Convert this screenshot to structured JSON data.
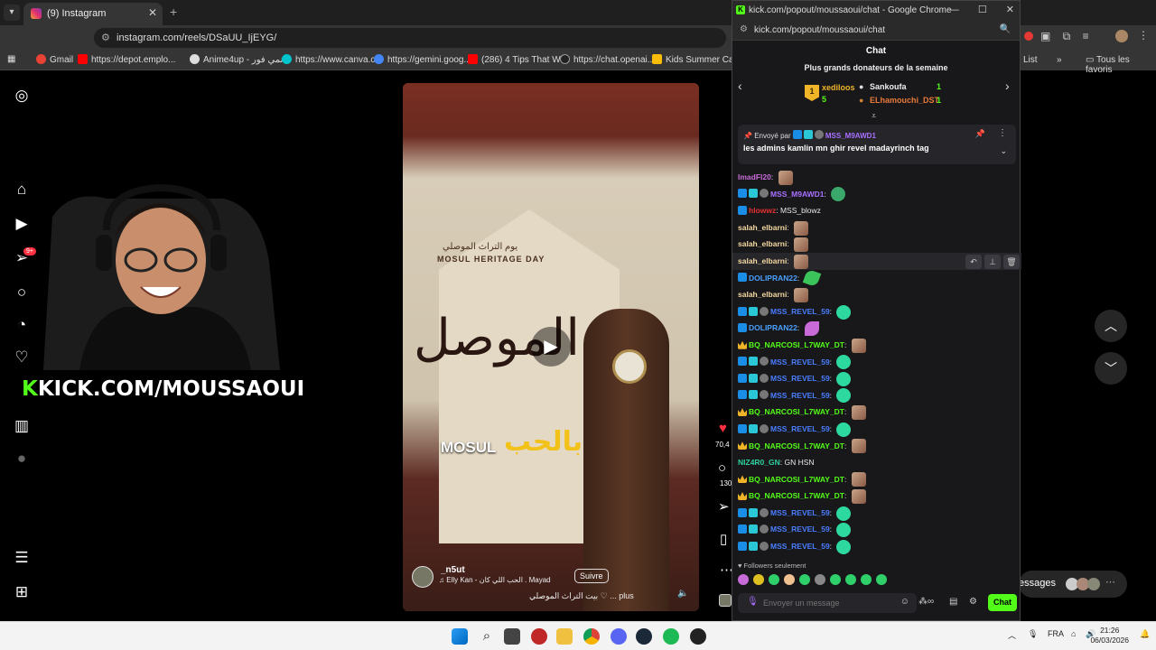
{
  "browser": {
    "tab_title": "(9) Instagram",
    "url": "instagram.com/reels/DSaUU_IjEYG/",
    "bookmarks": [
      "Gmail",
      "https://depot.emplo...",
      "Anime4up - انمي فور",
      "https://www.canva.c...",
      "https://gemini.goog...",
      "(286) 4 Tips That Wi...",
      "https://chat.openai....",
      "Kids Summer Camp..."
    ],
    "bookmarks_right": [
      "List",
      "Tous les favoris"
    ]
  },
  "overlay": {
    "kick_label": "KICK.COM/MOUSSAOUI",
    "kick_k": "K"
  },
  "instagram": {
    "notif_count": "9+",
    "reel": {
      "arabic_title": "الموصل",
      "small_arabic": "يوم التراث الموصلي",
      "small_english": "MOSUL HERITAGE DAY",
      "overlay_mosul": "MOSUL",
      "overlay_arabic": "بالحب",
      "user": "_n5ut",
      "follow": "Suivre",
      "music": "♫ Elly Kan - الحب اللي كان . Mayad",
      "caption": "بيت التراث الموصلي ♡ ... plus"
    },
    "actions": {
      "likes": "70,4",
      "comments": "130"
    },
    "messages_label": "essages"
  },
  "chat_window": {
    "title": "kick.com/popout/moussaoui/chat - Google Chrome",
    "url": "kick.com/popout/moussaoui/chat",
    "header": "Chat",
    "donors_title": "Plus grands donateurs de la semaine",
    "donors": [
      {
        "rank": "1",
        "name": "xediloos",
        "amount": "5"
      },
      {
        "name": "Sankoufa",
        "amount": "1"
      },
      {
        "name": "ELhamouchi_DST",
        "amount": "1"
      }
    ],
    "pinned": {
      "sent_by": "Envoyé par",
      "user": "MSS_M9AWD1",
      "message": "les admins kamlin mn ghir revel madayrinch tag"
    },
    "messages": [
      {
        "user": "ImadFl20",
        "color": "#c86bd8",
        "badges": [],
        "text": "",
        "emote": "em-photo"
      },
      {
        "user": "MSS_M9AWD1",
        "color": "#a970ff",
        "badges": [
          "b-mod",
          "b-vip",
          "b-gift"
        ],
        "text": "",
        "emote": "em-globe"
      },
      {
        "user": "hlowwz",
        "color": "#e83030",
        "badges": [
          "b-mod"
        ],
        "text": "MSS_blowz",
        "emote": ""
      },
      {
        "user": "salah_elbarni",
        "color": "#f5d8a0",
        "badges": [],
        "text": "",
        "emote": "em-photo"
      },
      {
        "user": "salah_elbarni",
        "color": "#f5d8a0",
        "badges": [],
        "text": "",
        "emote": "em-photo"
      },
      {
        "user": "salah_elbarni",
        "color": "#f5d8a0",
        "badges": [],
        "text": "",
        "emote": "em-photo",
        "hover": true
      },
      {
        "user": "DOLIPRAN22",
        "color": "#4aa0ff",
        "badges": [
          "b-mod"
        ],
        "text": "",
        "emote": "em-leaf"
      },
      {
        "user": "salah_elbarni",
        "color": "#f5d8a0",
        "badges": [],
        "text": "",
        "emote": "em-photo"
      },
      {
        "user": "MSS_REVEL_59",
        "color": "#4a7dff",
        "badges": [
          "b-mod",
          "b-vip",
          "b-gift"
        ],
        "text": "",
        "emote": "em-grin"
      },
      {
        "user": "DOLIPRAN22",
        "color": "#4aa0ff",
        "badges": [
          "b-mod"
        ],
        "text": "",
        "emote": "em-pink"
      },
      {
        "user": "BQ_NARCOSI_L7WAY_DT",
        "color": "#53fc18",
        "badges": [
          "b-crown"
        ],
        "text": "",
        "emote": "em-photo"
      },
      {
        "user": "MSS_REVEL_59",
        "color": "#4a7dff",
        "badges": [
          "b-mod",
          "b-vip",
          "b-gift"
        ],
        "text": "",
        "emote": "em-grin"
      },
      {
        "user": "MSS_REVEL_59",
        "color": "#4a7dff",
        "badges": [
          "b-mod",
          "b-vip",
          "b-gift"
        ],
        "text": "",
        "emote": "em-grin"
      },
      {
        "user": "MSS_REVEL_59",
        "color": "#4a7dff",
        "badges": [
          "b-mod",
          "b-vip",
          "b-gift"
        ],
        "text": "",
        "emote": "em-grin"
      },
      {
        "user": "BQ_NARCOSI_L7WAY_DT",
        "color": "#53fc18",
        "badges": [
          "b-crown"
        ],
        "text": "",
        "emote": "em-photo"
      },
      {
        "user": "MSS_REVEL_59",
        "color": "#4a7dff",
        "badges": [
          "b-mod",
          "b-vip",
          "b-gift"
        ],
        "text": "",
        "emote": "em-grin"
      },
      {
        "user": "BQ_NARCOSI_L7WAY_DT",
        "color": "#53fc18",
        "badges": [
          "b-crown"
        ],
        "text": "",
        "emote": "em-photo"
      },
      {
        "user": "NIZ4R0_GN",
        "color": "#2fd0a0",
        "badges": [],
        "text": "GN HSN",
        "emote": ""
      },
      {
        "user": "BQ_NARCOSI_L7WAY_DT",
        "color": "#53fc18",
        "badges": [
          "b-crown"
        ],
        "text": "",
        "emote": "em-photo"
      },
      {
        "user": "BQ_NARCOSI_L7WAY_DT",
        "color": "#53fc18",
        "badges": [
          "b-crown"
        ],
        "text": "",
        "emote": "em-photo"
      },
      {
        "user": "MSS_REVEL_59",
        "color": "#4a7dff",
        "badges": [
          "b-mod",
          "b-vip",
          "b-gift"
        ],
        "text": "",
        "emote": "em-grin"
      },
      {
        "user": "MSS_REVEL_59",
        "color": "#4a7dff",
        "badges": [
          "b-mod",
          "b-vip",
          "b-gift"
        ],
        "text": "",
        "emote": "em-grin"
      },
      {
        "user": "MSS_REVEL_59",
        "color": "#4a7dff",
        "badges": [
          "b-mod",
          "b-vip",
          "b-gift"
        ],
        "text": "",
        "emote": "em-grin"
      }
    ],
    "followers_only": "Followers seulement",
    "input_placeholder": "Envoyer un message",
    "send_label": "Chat"
  },
  "taskbar": {
    "lang": "FRA",
    "time": "21:26",
    "date": "06/03/2026"
  },
  "colors": {
    "kick_green": "#53fc18",
    "chat_bg": "#18181b"
  }
}
